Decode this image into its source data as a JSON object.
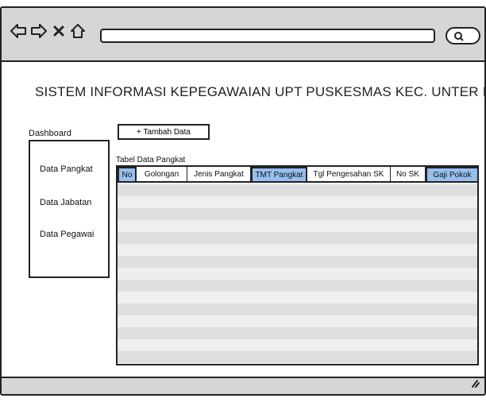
{
  "browser": {
    "address": "",
    "icons": [
      "back-arrow-icon",
      "forward-arrow-icon",
      "close-icon",
      "home-icon",
      "search-icon",
      "resize-grip-icon"
    ]
  },
  "page": {
    "title": "SISTEM INFORMASI KEPEGAWAIAN UPT PUSKESMAS KEC. UNTER IWES"
  },
  "sidebar": {
    "heading": "Dashboard",
    "items": [
      {
        "label": "Data Pangkat"
      },
      {
        "label": "Data Jabatan"
      },
      {
        "label": "Data Pegawai"
      }
    ]
  },
  "toolbar": {
    "add_label": "+ Tambah Data"
  },
  "table": {
    "caption": "Tabel Data Pangkat",
    "columns": [
      {
        "label": "No",
        "highlight": true
      },
      {
        "label": "Golongan",
        "highlight": false
      },
      {
        "label": "Jenis Pangkat",
        "highlight": false
      },
      {
        "label": "TMT Pangkat",
        "highlight": true
      },
      {
        "label": "Tgl Pengesahan SK",
        "highlight": false
      },
      {
        "label": "No SK",
        "highlight": false
      },
      {
        "label": "Gaji Pokok",
        "highlight": true
      }
    ],
    "rows": []
  },
  "colors": {
    "chrome": "#d6d6d6",
    "header_highlight": "#97bff0",
    "row_dark": "#dedede",
    "row_light": "#efefef",
    "outline": "#222222"
  }
}
